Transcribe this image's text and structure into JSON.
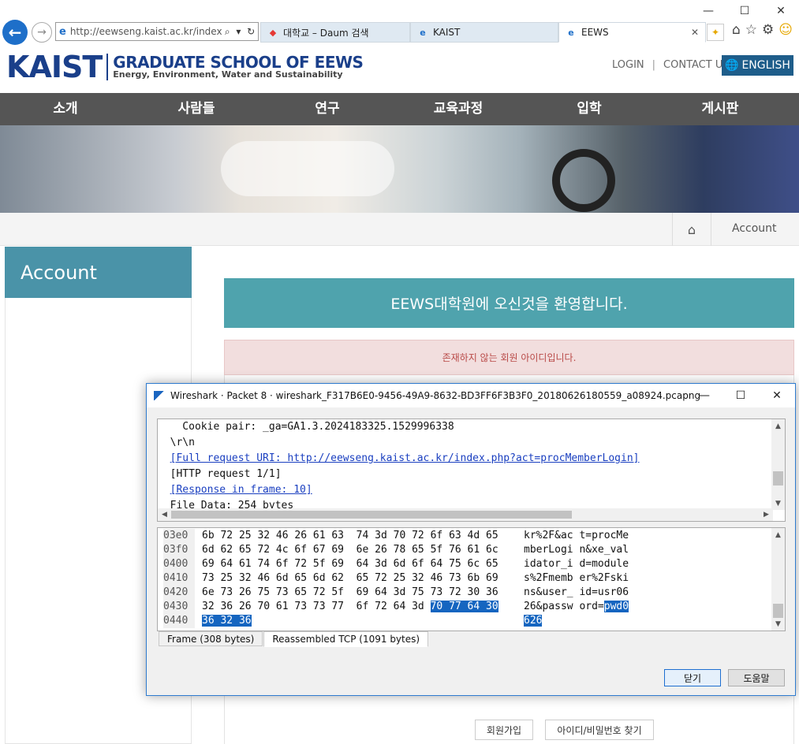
{
  "browser": {
    "address": "http://eewseng.kaist.ac.kr/index.p",
    "address_host": "kaist.ac.kr",
    "tabs": [
      {
        "label": "대학교 – Daum 검색"
      },
      {
        "label": "KAIST"
      },
      {
        "label": "EEWS"
      }
    ]
  },
  "site": {
    "logo_kaist": "KAIST",
    "logo_title": "GRADUATE SCHOOL OF EEWS",
    "logo_sub": "Energy, Environment, Water and Sustainability",
    "login": "LOGIN",
    "contact": "CONTACT US",
    "english": "ENGLISH",
    "menu": [
      "소개",
      "사람들",
      "연구",
      "교육과정",
      "입학",
      "게시판"
    ],
    "breadcrumb": "Account",
    "sidebar_title": "Account",
    "welcome": "EEWS대학원에 오신것을 환영합니다.",
    "alert": "존재하지 않는 회원 아이디입니다.",
    "join_button": "회원가입",
    "find_button": "아이디/비밀번호 찾기"
  },
  "wireshark": {
    "title": "Wireshark · Packet 8 · wireshark_F317B6E0-9456-49A9-8632-BD3FF6F3B3F0_20180626180559_a08924.pcapng",
    "detail_lines": [
      {
        "text": "    Cookie pair: _ga=GA1.3.2024183325.1529996338",
        "link": false
      },
      {
        "text": "  \\r\\n",
        "link": false
      },
      {
        "text": "  [Full request URI: http://eewseng.kaist.ac.kr/index.php?act=procMemberLogin]",
        "link": true
      },
      {
        "text": "  [HTTP request 1/1]",
        "link": false
      },
      {
        "text": "  [Response in frame: 10]",
        "link": true
      },
      {
        "text": "  File Data: 254 bytes",
        "link": false
      }
    ],
    "hex_rows": [
      {
        "offset": "03e0",
        "hex": "6b 72 25 32 46 26 61 63  74 3d 70 72 6f 63 4d 65",
        "hex_hl": "",
        "ascii": "kr%2F&ac t=procMe",
        "ascii_hl": ""
      },
      {
        "offset": "03f0",
        "hex": "6d 62 65 72 4c 6f 67 69  6e 26 78 65 5f 76 61 6c",
        "hex_hl": "",
        "ascii": "mberLogi n&xe_val",
        "ascii_hl": ""
      },
      {
        "offset": "0400",
        "hex": "69 64 61 74 6f 72 5f 69  64 3d 6d 6f 64 75 6c 65",
        "hex_hl": "",
        "ascii": "idator_i d=module",
        "ascii_hl": ""
      },
      {
        "offset": "0410",
        "hex": "73 25 32 46 6d 65 6d 62  65 72 25 32 46 73 6b 69",
        "hex_hl": "",
        "ascii": "s%2Fmemb er%2Fski",
        "ascii_hl": ""
      },
      {
        "offset": "0420",
        "hex": "6e 73 26 75 73 65 72 5f  69 64 3d 75 73 72 30 36",
        "hex_hl": "",
        "ascii": "ns&user_ id=usr06",
        "ascii_hl": ""
      },
      {
        "offset": "0430",
        "hex": "32 36 26 70 61 73 73 77  6f 72 64 3d ",
        "hex_hl": "70 77 64 30",
        "ascii": "26&passw ord=",
        "ascii_hl": "pwd0"
      },
      {
        "offset": "0440",
        "hex": "",
        "hex_hl": "36 32 36",
        "ascii": "",
        "ascii_hl": "626"
      }
    ],
    "tabs": [
      "Frame (308 bytes)",
      "Reassembled TCP (1091 bytes)"
    ],
    "close_button": "닫기",
    "help_button": "도움말"
  }
}
